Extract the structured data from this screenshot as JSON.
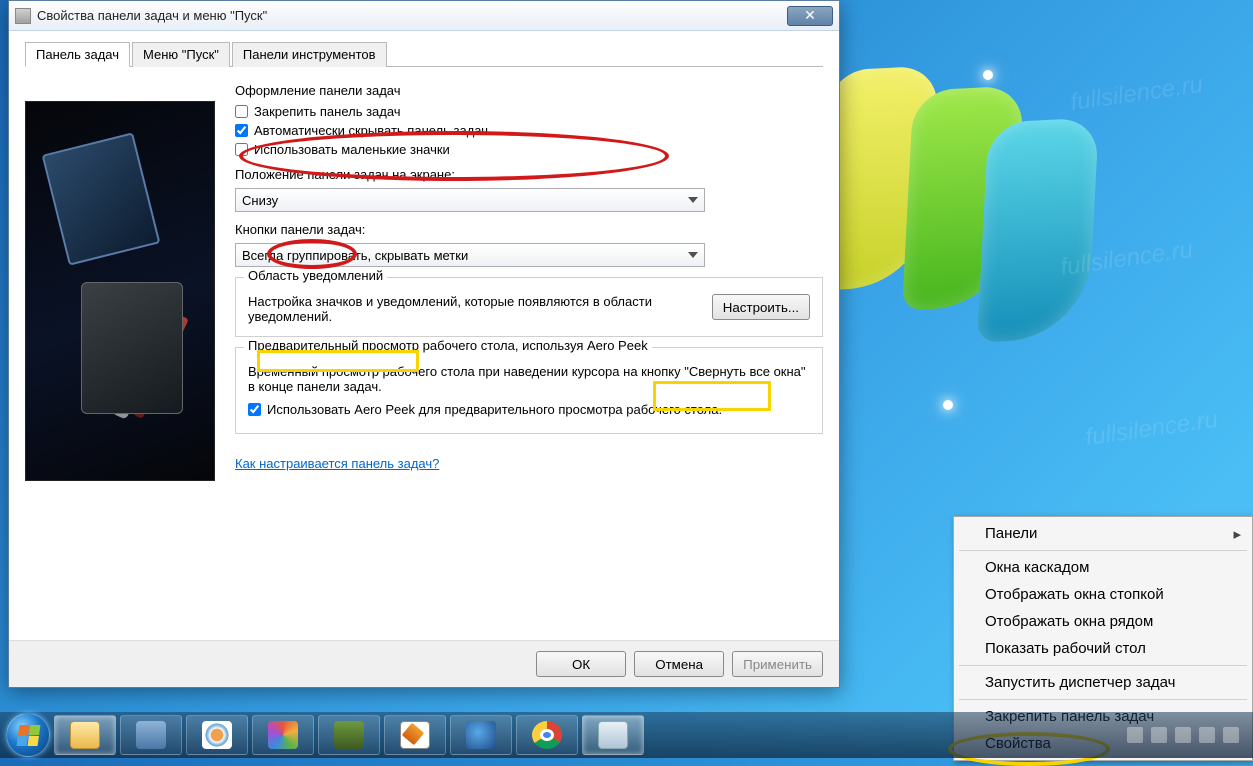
{
  "window": {
    "title": "Свойства панели задач и меню \"Пуск\""
  },
  "tabs": {
    "taskbar": "Панель задач",
    "start": "Меню \"Пуск\"",
    "toolbars": "Панели инструментов"
  },
  "main": {
    "appearance_heading": "Оформление панели задач",
    "lock_taskbar": "Закрепить панель задач",
    "auto_hide": "Автоматически скрывать панель задач",
    "small_icons": "Использовать маленькие значки",
    "position_label": "Положение панели задач на экране:",
    "position_value": "Снизу",
    "buttons_label": "Кнопки панели задач:",
    "buttons_value": "Всегда группировать, скрывать метки",
    "notify_legend": "Область уведомлений",
    "notify_text": "Настройка значков и уведомлений, которые появляются в области уведомлений.",
    "customize_btn": "Настроить...",
    "aero_heading": "Предварительный просмотр рабочего стола, используя Aero Peek",
    "aero_desc": "Временный просмотр рабочего стола при наведении курсора на кнопку \"Свернуть все окна\" в конце панели задач.",
    "aero_check": "Использовать Aero Peek для предварительного просмотра рабочего стола.",
    "help_link": "Как настраивается панель задач?"
  },
  "buttons": {
    "ok": "ОК",
    "cancel": "Отмена",
    "apply": "Применить"
  },
  "context_menu": {
    "panels": "Панели",
    "cascade": "Окна каскадом",
    "stack": "Отображать окна стопкой",
    "side": "Отображать окна рядом",
    "show_desktop": "Показать рабочий стол",
    "task_manager": "Запустить диспетчер задач",
    "lock_taskbar": "Закрепить панель задач",
    "properties": "Свойства"
  },
  "watermark": "fullsilence.ru"
}
